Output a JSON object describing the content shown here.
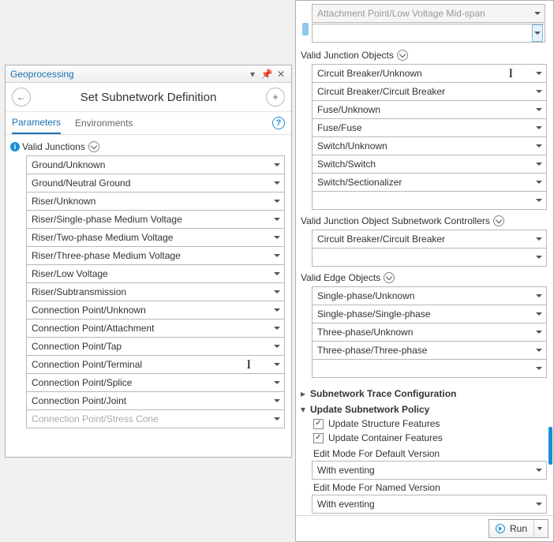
{
  "left": {
    "panel_title": "Geoprocessing",
    "tool_title": "Set Subnetwork Definition",
    "tabs": {
      "parameters": "Parameters",
      "environments": "Environments"
    },
    "valid_junctions_label": "Valid Junctions",
    "valid_junctions": [
      "Ground/Unknown",
      "Ground/Neutral Ground",
      "Riser/Unknown",
      "Riser/Single-phase Medium Voltage",
      "Riser/Two-phase Medium Voltage",
      "Riser/Three-phase Medium Voltage",
      "Riser/Low Voltage",
      "Riser/Subtransmission",
      "Connection Point/Unknown",
      "Connection Point/Attachment",
      "Connection Point/Tap",
      "Connection Point/Terminal",
      "Connection Point/Splice",
      "Connection Point/Joint"
    ],
    "valid_junctions_overflow": "Connection Point/Stress Cone"
  },
  "right": {
    "top_disabled": "Attachment Point/Low Voltage Mid-span",
    "vjo_label": "Valid Junction Objects",
    "vjo": [
      "Circuit Breaker/Unknown",
      "Circuit Breaker/Circuit Breaker",
      "Fuse/Unknown",
      "Fuse/Fuse",
      "Switch/Unknown",
      "Switch/Switch",
      "Switch/Sectionalizer"
    ],
    "vjosc_label": "Valid Junction Object Subnetwork Controllers",
    "vjosc": [
      "Circuit Breaker/Circuit Breaker"
    ],
    "veo_label": "Valid Edge Objects",
    "veo": [
      "Single-phase/Unknown",
      "Single-phase/Single-phase",
      "Three-phase/Unknown",
      "Three-phase/Three-phase"
    ],
    "trace_group": "Subnetwork Trace Configuration",
    "policy_group": "Update Subnetwork Policy",
    "policy": {
      "update_structure": "Update Structure Features",
      "update_container": "Update Container Features",
      "edit_default_label": "Edit Mode For Default Version",
      "edit_default_value": "With eventing",
      "edit_named_label": "Edit Mode For Named Version",
      "edit_named_value": "With eventing"
    },
    "run_label": "Run"
  }
}
